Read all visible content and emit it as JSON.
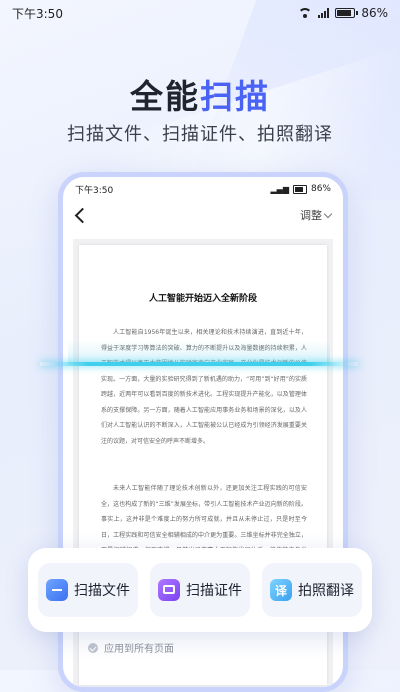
{
  "status_bar": {
    "time": "下午3:50",
    "battery": "86%"
  },
  "hero": {
    "title_main": "全能",
    "title_accent": "扫描",
    "subtitle": "扫描文件、扫描证件、拍照翻译",
    "accent_color": "#4a63f5"
  },
  "phone": {
    "status_time": "下午3:50",
    "status_battery": "86%",
    "nav_adjust_label": "调整",
    "document": {
      "title": "人工智能开始迈入全新阶段",
      "paragraph1": "人工智能自1956年诞生以来，相关理论和技术持续演进，直到近十年，得益于深度学习等算法的突破、算力的不断提升以及海量数据的持续积累，人工智能才得以真正大范围地从实验室走向产业实践。产业化是技术创新的价值实现。一方面，大量的实验研究得到了新机遇的助力，“可用”到“好用”的实质跨越，近两年可以看到百度的新技术进化。工程实现提升产能化，以及管理体系的支撑保障。另一方面，随着人工智能应用事务业务和场景的深化，以及人们对人工智能认识的不断深入，人工智能被公认已经成为引领经济发展重要关注的议题，对可信安全的呼声不断增多。",
      "paragraph2": "未来人工智能伴随了理论技术创新以外，还更加关注工程实践的可信安全，这也构成了新的“三维”发展坐标，带引人工智能技术产业迈向新的阶段。事实上，这并非是个难度上的努力所可成就，并且从未停止过，只是时至今日，工程实践和可信安全相辅相成的中介更为重要。三维坐标并非完全独立，而是相辅相成、相互支撑，目前出了丰富人工智能发展体系，将使其中各类人、各类的关键因素发展已经出了稳步方向去发展。"
    }
  },
  "features": [
    {
      "label": "扫描文件",
      "icon": "document-scan-icon"
    },
    {
      "label": "扫描证件",
      "icon": "id-card-scan-icon"
    },
    {
      "label": "拍照翻译",
      "icon": "translate-icon",
      "glyph": "译"
    }
  ],
  "apply_all": "应用到所有页面"
}
